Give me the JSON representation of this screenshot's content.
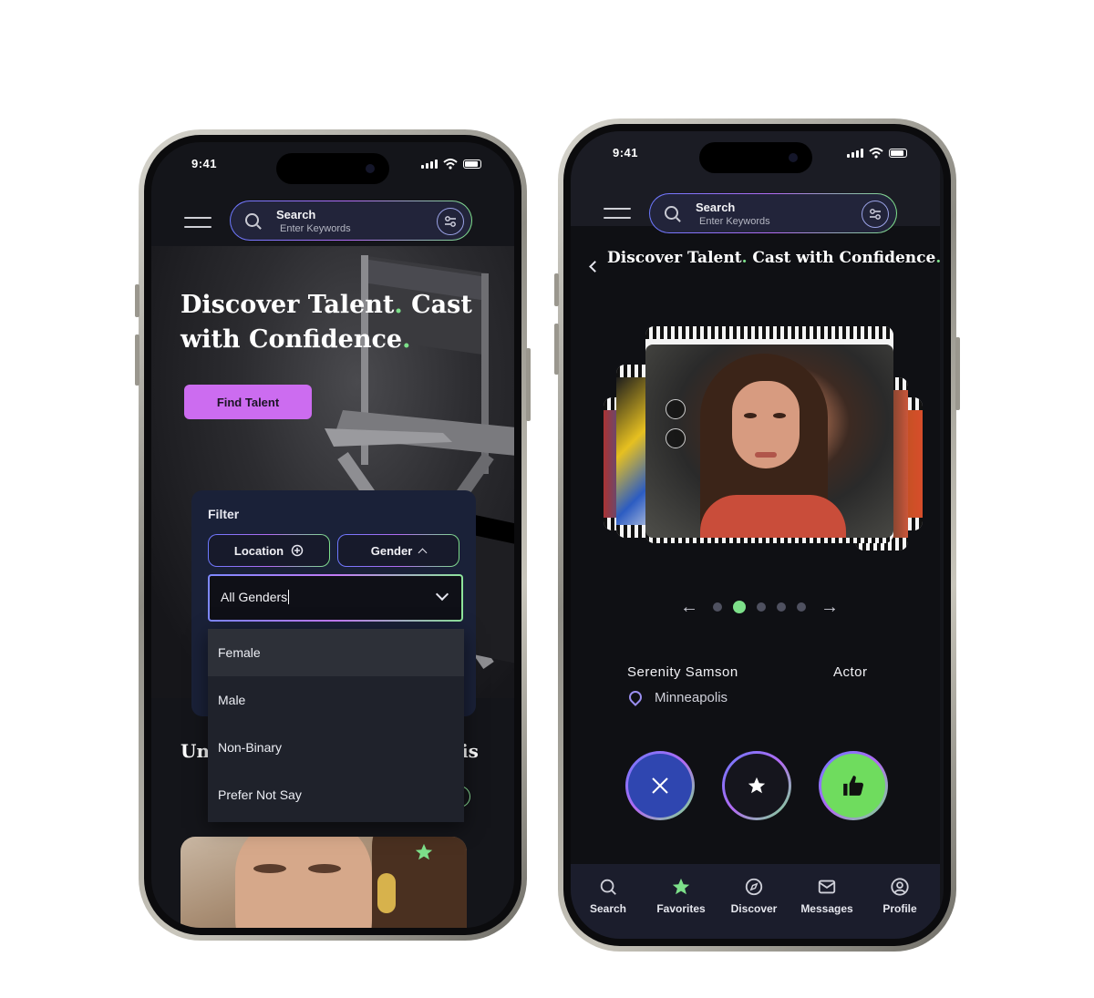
{
  "status": {
    "time": "9:41"
  },
  "search": {
    "label": "Search",
    "placeholder": "Enter Keywords"
  },
  "home": {
    "hero_title_part1": "Discover Talent",
    "hero_title_part2": " Cast with Confidence",
    "dot": ".",
    "cta": "Find Talent",
    "filter": {
      "title": "Filter",
      "chips": [
        {
          "label": "Location"
        },
        {
          "label": "Gender"
        }
      ],
      "gender_select_value": "All Genders",
      "options": [
        "Female",
        "Male",
        "Non-Binary",
        "Prefer Not Say"
      ]
    },
    "section_title_left": "Un",
    "section_title_right": "is"
  },
  "discover": {
    "title_part1": "Discover Talent",
    "title_part2": " Cast with Confidence",
    "dot": ".",
    "carousel": {
      "total": 5,
      "active_index": 1
    },
    "profile": {
      "name": "Serenity Samson",
      "role": "Actor",
      "location": "Minneapolis"
    },
    "actions": [
      {
        "name": "reject",
        "icon": "close-icon",
        "color": "#2f46b0"
      },
      {
        "name": "favorite",
        "icon": "star-icon",
        "color": "#15151d"
      },
      {
        "name": "like",
        "icon": "thumbs-up-icon",
        "color": "#6fdc5e"
      }
    ]
  },
  "tabbar": {
    "tabs": [
      {
        "label": "Search",
        "icon": "search-icon"
      },
      {
        "label": "Favorites",
        "icon": "star-icon",
        "active": true
      },
      {
        "label": "Discover",
        "icon": "compass-icon"
      },
      {
        "label": "Messages",
        "icon": "mail-icon"
      },
      {
        "label": "Profile",
        "icon": "user-icon"
      }
    ]
  },
  "colors": {
    "accent_purple": "#cc6cf0",
    "accent_green": "#7de08a",
    "bg_dark": "#14151a"
  }
}
